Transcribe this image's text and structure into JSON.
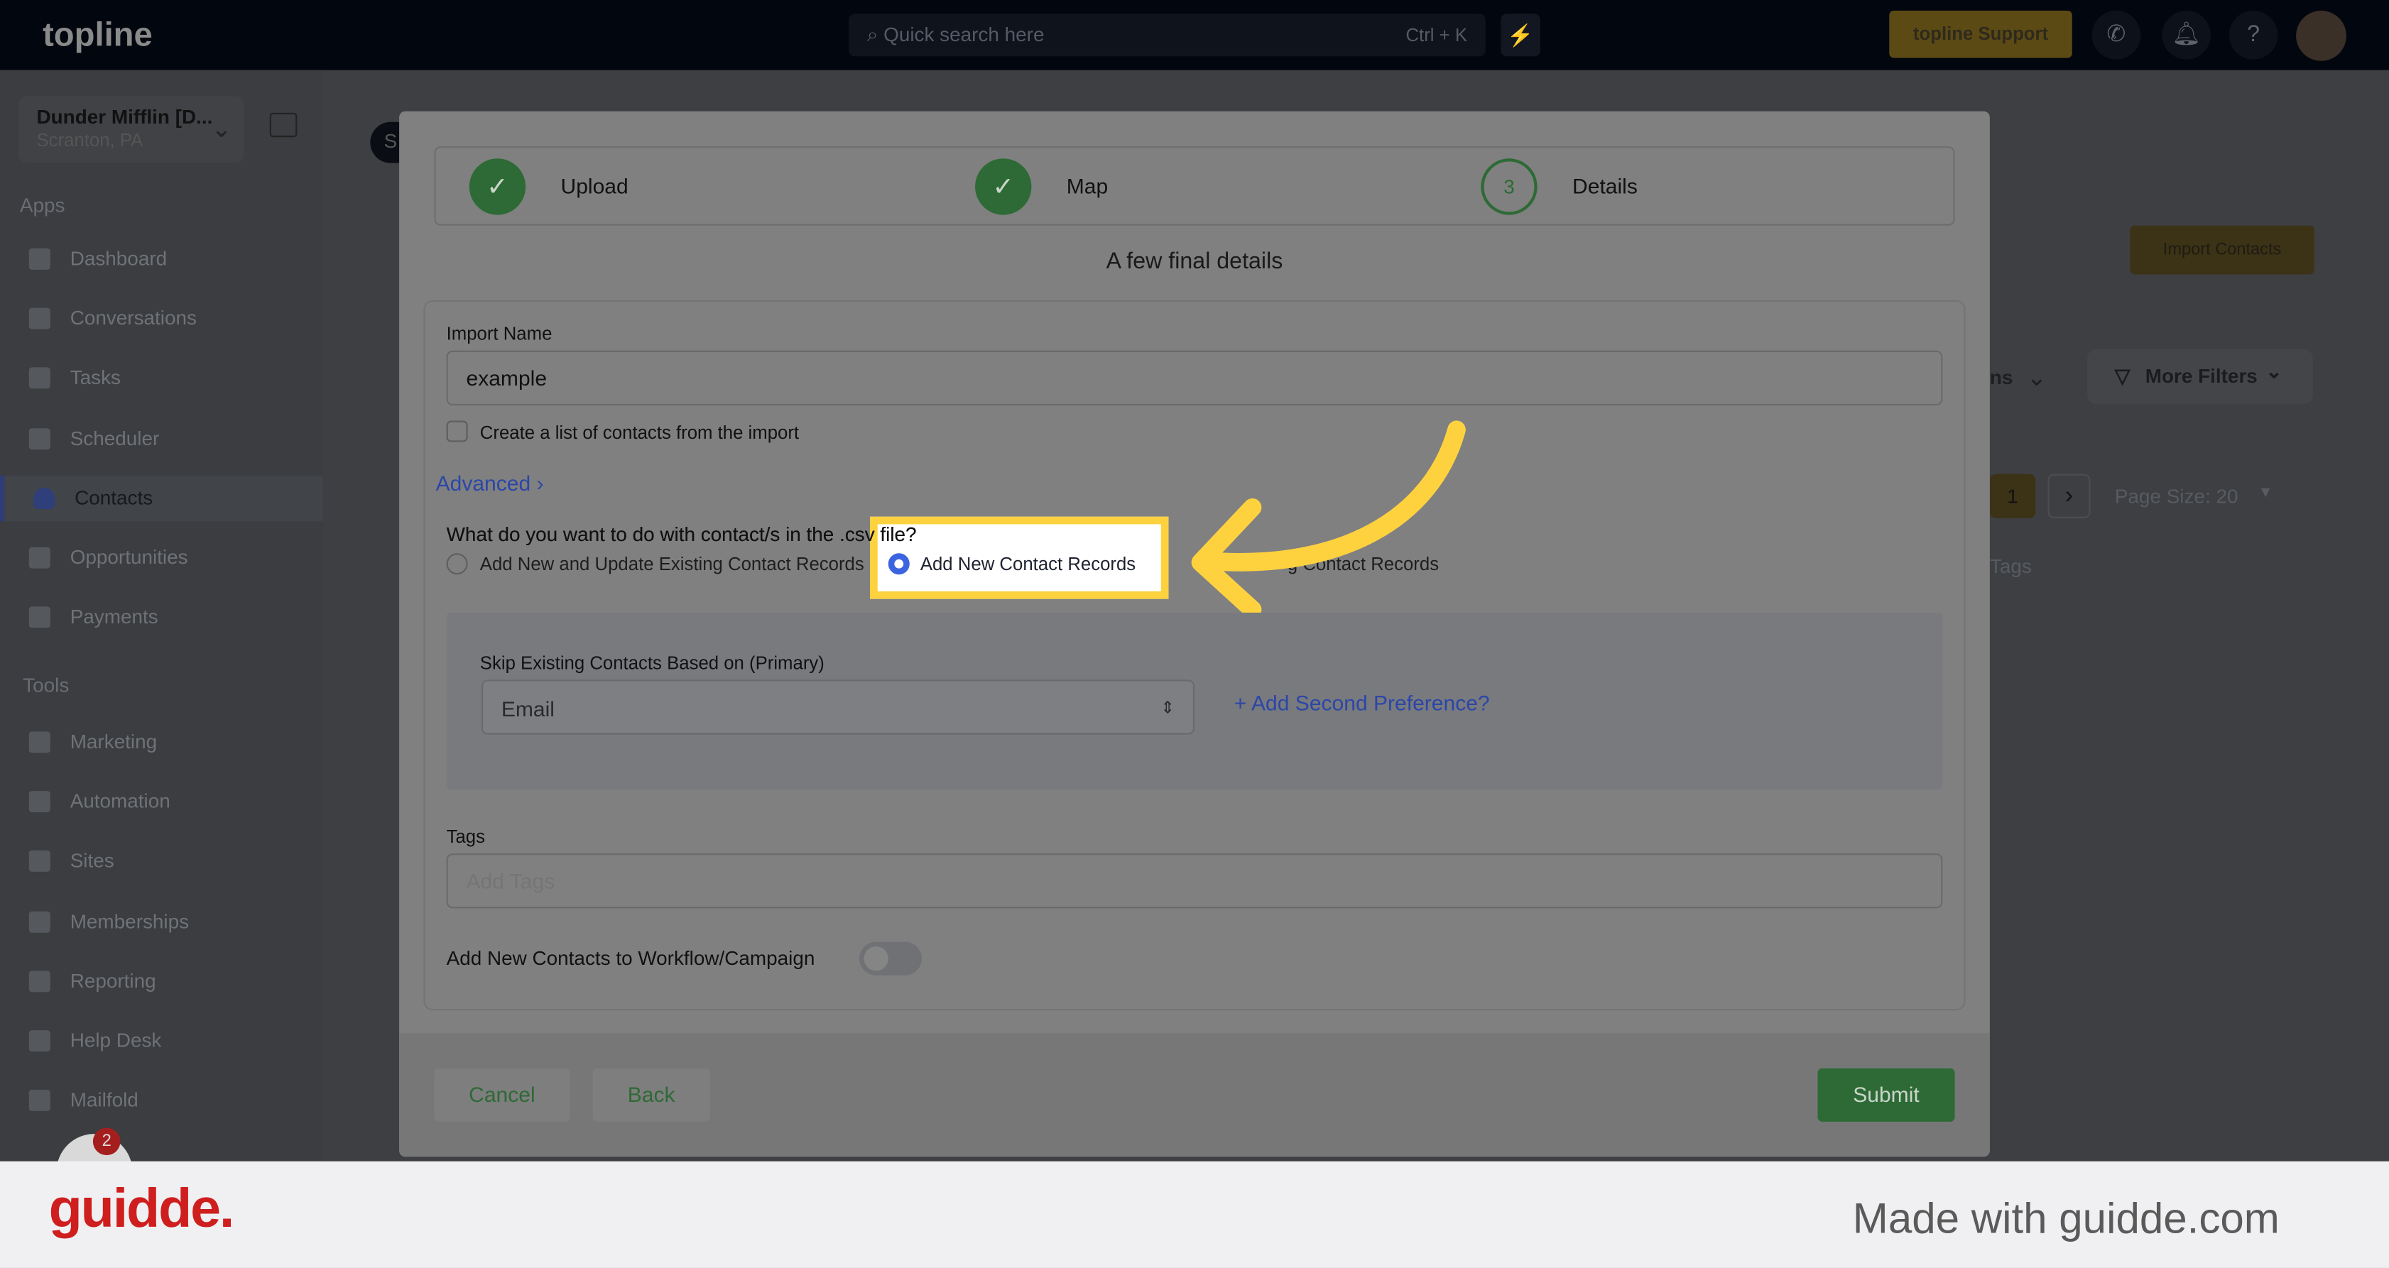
{
  "topbar": {
    "logo": "topline",
    "search_placeholder": "Quick search here",
    "search_shortcut": "Ctrl + K",
    "support_label": "topline Support"
  },
  "sidebar": {
    "account_name": "Dunder Mifflin [D...",
    "account_location": "Scranton, PA",
    "apps_heading": "Apps",
    "tools_heading": "Tools",
    "apps": [
      {
        "label": "Dashboard"
      },
      {
        "label": "Conversations"
      },
      {
        "label": "Tasks"
      },
      {
        "label": "Scheduler"
      },
      {
        "label": "Contacts",
        "active": true
      },
      {
        "label": "Opportunities"
      },
      {
        "label": "Payments"
      }
    ],
    "tools": [
      {
        "label": "Marketing"
      },
      {
        "label": "Automation"
      },
      {
        "label": "Sites"
      },
      {
        "label": "Memberships"
      },
      {
        "label": "Reporting"
      },
      {
        "label": "Help Desk"
      },
      {
        "label": "Mailfold"
      }
    ],
    "badge_count": "2"
  },
  "background": {
    "import_contacts": "Import Contacts",
    "columns_partial": "ns",
    "more_filters": "More Filters",
    "page": "1",
    "page_size": "Page Size: 20",
    "tags_header": "Tags",
    "tab_partial": "S"
  },
  "modal": {
    "steps": [
      {
        "label": "Upload",
        "state": "done"
      },
      {
        "label": "Map",
        "state": "done"
      },
      {
        "label": "Details",
        "number": "3",
        "state": "current"
      }
    ],
    "subtitle": "A few final details",
    "import_name_label": "Import Name",
    "import_name_value": "example",
    "create_list_label": "Create a list of contacts from the import",
    "advanced_label": "Advanced",
    "question": "What do you want to do with contact/s in the .csv file?",
    "question_prefix": "What do you want to do with contact/s in the ",
    "question_suffix": ".csv file?",
    "options": [
      {
        "label": "Add New and Update Existing Contact Records",
        "selected": false
      },
      {
        "label": "Add New Contact Records",
        "selected": true
      },
      {
        "label": "Update Existing Contact Records",
        "visible_label": "g Contact Records",
        "selected": false
      }
    ],
    "skip_label": "Skip Existing Contacts Based on (Primary)",
    "skip_value": "Email",
    "add_pref": "Add Second Preference?",
    "tags_label": "Tags",
    "tags_placeholder": "Add Tags",
    "workflow_label": "Add New Contacts to Workflow/Campaign",
    "workflow_on": false,
    "cancel": "Cancel",
    "back": "Back",
    "submit": "Submit"
  },
  "colors": {
    "highlight": "#fed23f",
    "success": "#2d6a35",
    "link": "#2c46a8",
    "radio_selected": "#3c63e0"
  },
  "footer": {
    "brand": "guidde.",
    "made_with": "Made with guidde.com"
  }
}
